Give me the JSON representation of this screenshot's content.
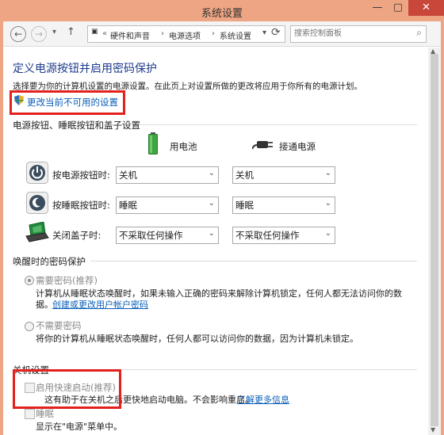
{
  "window": {
    "title": "系统设置",
    "min_glyph": "—",
    "max_glyph": "▢",
    "close_glyph": "✕"
  },
  "nav": {
    "back_glyph": "←",
    "forward_glyph": "→",
    "down_glyph": "▾",
    "up_glyph": "↑",
    "breadcrumb_sep": "«",
    "breadcrumb": [
      "硬件和声音",
      "电源选项",
      "系统设置"
    ],
    "refresh_glyph": "⟳",
    "search_placeholder": "搜索控制面板"
  },
  "heading": "定义电源按钮并启用密码保护",
  "subtitle": "选择要为你的计算机设置的电源设置。在此页上对设置所做的更改将应用于你所有的电源计划。",
  "change_link": "更改当前不可用的设置",
  "power_section": {
    "title": "电源按钮、睡眠按钮和盖子设置",
    "col_battery": "用电池",
    "col_plugged": "接通电源",
    "rows": [
      {
        "label": "按电源按钮时:",
        "battery": "关机",
        "plugged": "关机"
      },
      {
        "label": "按睡眠按钮时:",
        "battery": "睡眠",
        "plugged": "睡眠"
      },
      {
        "label": "关闭盖子时:",
        "battery": "不采取任何操作",
        "plugged": "不采取任何操作"
      }
    ]
  },
  "wake_section": {
    "title": "唤醒时的密码保护",
    "require_label": "需要密码(推荐)",
    "require_desc": "计算机从睡眠状态唤醒时，如果未输入正确的密码来解除计算机锁定，任何人都无法访问你的数",
    "require_desc2": "据。",
    "account_link": "创建或更改用户帐户密码",
    "norequire_label": "不需要密码",
    "norequire_desc": "将你的计算机从睡眠状态唤醒时，任何人都可以访问你的数据，因为计算机未锁定。"
  },
  "shutdown_section": {
    "title": "关机设置",
    "fast_startup_label": "启用快速启动(推荐)",
    "fast_startup_desc": "这有助于在关机之后更快地启动电脑。不会影响重启。",
    "learn_more": "了解更多信息",
    "sleep_label": "睡眠",
    "sleep_desc": "显示在\"电源\"菜单中。"
  },
  "arrow_glyph": "⌄",
  "colors": {
    "title_bar": "#eda583",
    "close": "#c8463a",
    "heading": "#1e3b8c",
    "link": "#0a5fb8",
    "highlight": "#e3201c"
  }
}
